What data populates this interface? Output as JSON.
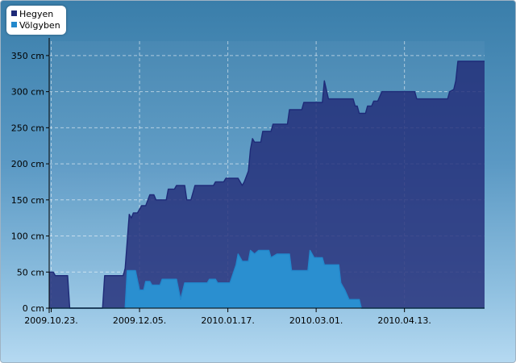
{
  "legend": [
    {
      "name": "Hegyen",
      "color": "#1e2a78"
    },
    {
      "name": "Völgyben",
      "color": "#2288cc"
    }
  ],
  "chart_data": {
    "type": "area",
    "title": "",
    "xlabel": "",
    "ylabel": "",
    "y_unit": "cm",
    "ylim": [
      0,
      370
    ],
    "xlim": [
      "2009-10-22",
      "2010-05-22"
    ],
    "grid": true,
    "legend_position": "top-left",
    "y_ticks": [
      "0 cm",
      "50 cm",
      "100 cm",
      "150 cm",
      "200 cm",
      "250 cm",
      "300 cm",
      "350 cm"
    ],
    "y_tick_values": [
      0,
      50,
      100,
      150,
      200,
      250,
      300,
      350
    ],
    "x_ticks": [
      "2009.10.23.",
      "2009.12.05.",
      "2010.01.17.",
      "2010.03.01.",
      "2010.04.13."
    ],
    "x_tick_values": [
      "2009-10-23",
      "2009-12-05",
      "2010-01-17",
      "2010-03-01",
      "2010-04-13"
    ],
    "series": [
      {
        "name": "Hegyen",
        "color": "#1e2a78",
        "fill": "#3a4c92",
        "points": [
          [
            "2009-10-22",
            50
          ],
          [
            "2009-10-24",
            50
          ],
          [
            "2009-10-25",
            45
          ],
          [
            "2009-10-31",
            45
          ],
          [
            "2009-11-01",
            0
          ],
          [
            "2009-11-17",
            0
          ],
          [
            "2009-11-18",
            45
          ],
          [
            "2009-11-27",
            45
          ],
          [
            "2009-11-28",
            55
          ],
          [
            "2009-11-30",
            130
          ],
          [
            "2009-12-01",
            125
          ],
          [
            "2009-12-02",
            132
          ],
          [
            "2009-12-04",
            132
          ],
          [
            "2009-12-06",
            142
          ],
          [
            "2009-12-08",
            142
          ],
          [
            "2009-12-10",
            157
          ],
          [
            "2009-12-12",
            157
          ],
          [
            "2009-12-13",
            150
          ],
          [
            "2009-12-18",
            150
          ],
          [
            "2009-12-19",
            165
          ],
          [
            "2009-12-22",
            165
          ],
          [
            "2009-12-23",
            170
          ],
          [
            "2009-12-27",
            170
          ],
          [
            "2009-12-28",
            150
          ],
          [
            "2009-12-30",
            150
          ],
          [
            "2010-01-01",
            170
          ],
          [
            "2010-01-10",
            170
          ],
          [
            "2010-01-11",
            175
          ],
          [
            "2010-01-15",
            175
          ],
          [
            "2010-01-16",
            180
          ],
          [
            "2010-01-22",
            180
          ],
          [
            "2010-01-24",
            170
          ],
          [
            "2010-01-25",
            175
          ],
          [
            "2010-01-27",
            190
          ],
          [
            "2010-01-28",
            220
          ],
          [
            "2010-01-29",
            235
          ],
          [
            "2010-01-30",
            230
          ],
          [
            "2010-02-02",
            230
          ],
          [
            "2010-02-03",
            245
          ],
          [
            "2010-02-07",
            245
          ],
          [
            "2010-02-08",
            255
          ],
          [
            "2010-02-15",
            255
          ],
          [
            "2010-02-16",
            275
          ],
          [
            "2010-02-22",
            275
          ],
          [
            "2010-02-23",
            285
          ],
          [
            "2010-03-04",
            285
          ],
          [
            "2010-03-05",
            315
          ],
          [
            "2010-03-07",
            290
          ],
          [
            "2010-03-19",
            290
          ],
          [
            "2010-03-20",
            280
          ],
          [
            "2010-03-21",
            280
          ],
          [
            "2010-03-22",
            270
          ],
          [
            "2010-03-25",
            270
          ],
          [
            "2010-03-26",
            280
          ],
          [
            "2010-03-28",
            280
          ],
          [
            "2010-03-29",
            287
          ],
          [
            "2010-03-31",
            287
          ],
          [
            "2010-04-02",
            300
          ],
          [
            "2010-04-18",
            300
          ],
          [
            "2010-04-19",
            290
          ],
          [
            "2010-05-04",
            290
          ],
          [
            "2010-05-05",
            300
          ],
          [
            "2010-05-07",
            303
          ],
          [
            "2010-05-08",
            315
          ],
          [
            "2010-05-09",
            342
          ],
          [
            "2010-05-22",
            342
          ]
        ]
      },
      {
        "name": "Völgyben",
        "color": "#2288cc",
        "fill": "#2a8fd0",
        "points": [
          [
            "2009-10-22",
            0
          ],
          [
            "2009-11-28",
            0
          ],
          [
            "2009-11-29",
            52
          ],
          [
            "2009-12-03",
            52
          ],
          [
            "2009-12-05",
            25
          ],
          [
            "2009-12-07",
            25
          ],
          [
            "2009-12-08",
            37
          ],
          [
            "2009-12-10",
            37
          ],
          [
            "2009-12-11",
            32
          ],
          [
            "2009-12-15",
            32
          ],
          [
            "2009-12-16",
            40
          ],
          [
            "2009-12-23",
            40
          ],
          [
            "2009-12-25",
            12
          ],
          [
            "2009-12-27",
            35
          ],
          [
            "2010-01-07",
            35
          ],
          [
            "2010-01-08",
            40
          ],
          [
            "2010-01-11",
            40
          ],
          [
            "2010-01-12",
            35
          ],
          [
            "2010-01-18",
            35
          ],
          [
            "2010-01-21",
            60
          ],
          [
            "2010-01-22",
            75
          ],
          [
            "2010-01-24",
            65
          ],
          [
            "2010-01-27",
            65
          ],
          [
            "2010-01-28",
            80
          ],
          [
            "2010-01-30",
            75
          ],
          [
            "2010-02-01",
            80
          ],
          [
            "2010-02-06",
            80
          ],
          [
            "2010-02-07",
            70
          ],
          [
            "2010-02-10",
            75
          ],
          [
            "2010-02-16",
            75
          ],
          [
            "2010-02-17",
            52
          ],
          [
            "2010-02-25",
            52
          ],
          [
            "2010-02-26",
            80
          ],
          [
            "2010-02-28",
            70
          ],
          [
            "2010-03-04",
            70
          ],
          [
            "2010-03-05",
            60
          ],
          [
            "2010-03-12",
            60
          ],
          [
            "2010-03-13",
            35
          ],
          [
            "2010-03-15",
            25
          ],
          [
            "2010-03-17",
            12
          ],
          [
            "2010-03-22",
            12
          ],
          [
            "2010-03-23",
            0
          ],
          [
            "2010-05-22",
            0
          ]
        ]
      }
    ]
  }
}
